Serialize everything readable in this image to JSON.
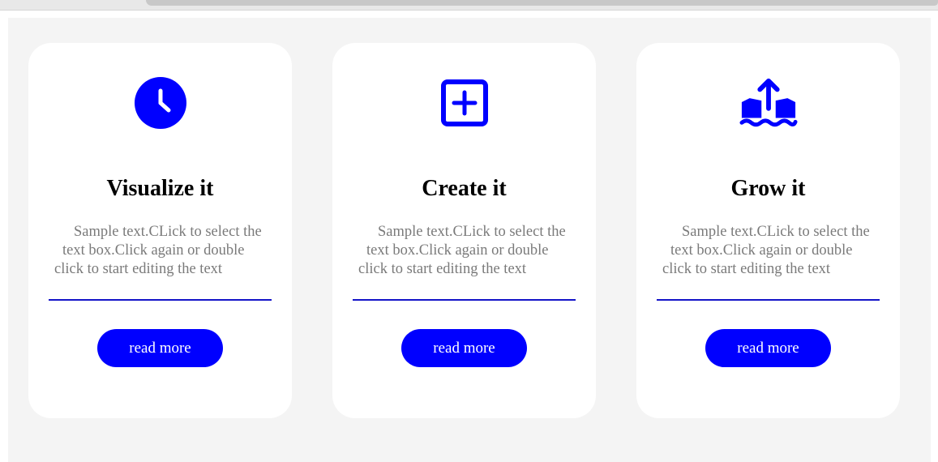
{
  "colors": {
    "accent": "#0000ff",
    "divider": "#1414c8",
    "body_text": "#7a7a7a",
    "card_bg": "#ffffff",
    "stage_bg": "#f4f4f4"
  },
  "cards": [
    {
      "icon": "clock-icon",
      "title": "Visualize it",
      "text_lines": [
        "Sample text.CLick to select the",
        "text box.Click again or double",
        "click to start editing the text"
      ],
      "button_label": "read more"
    },
    {
      "icon": "plus-square-icon",
      "title": "Create it",
      "text_lines": [
        "Sample text.CLick to select the",
        "text box.Click again or double",
        "click to start editing the text"
      ],
      "button_label": "read more"
    },
    {
      "icon": "growth-upload-icon",
      "title": "Grow it",
      "text_lines": [
        "Sample text.CLick to select the",
        "text box.Click again or double",
        "click to start editing the text"
      ],
      "button_label": "read more"
    }
  ]
}
